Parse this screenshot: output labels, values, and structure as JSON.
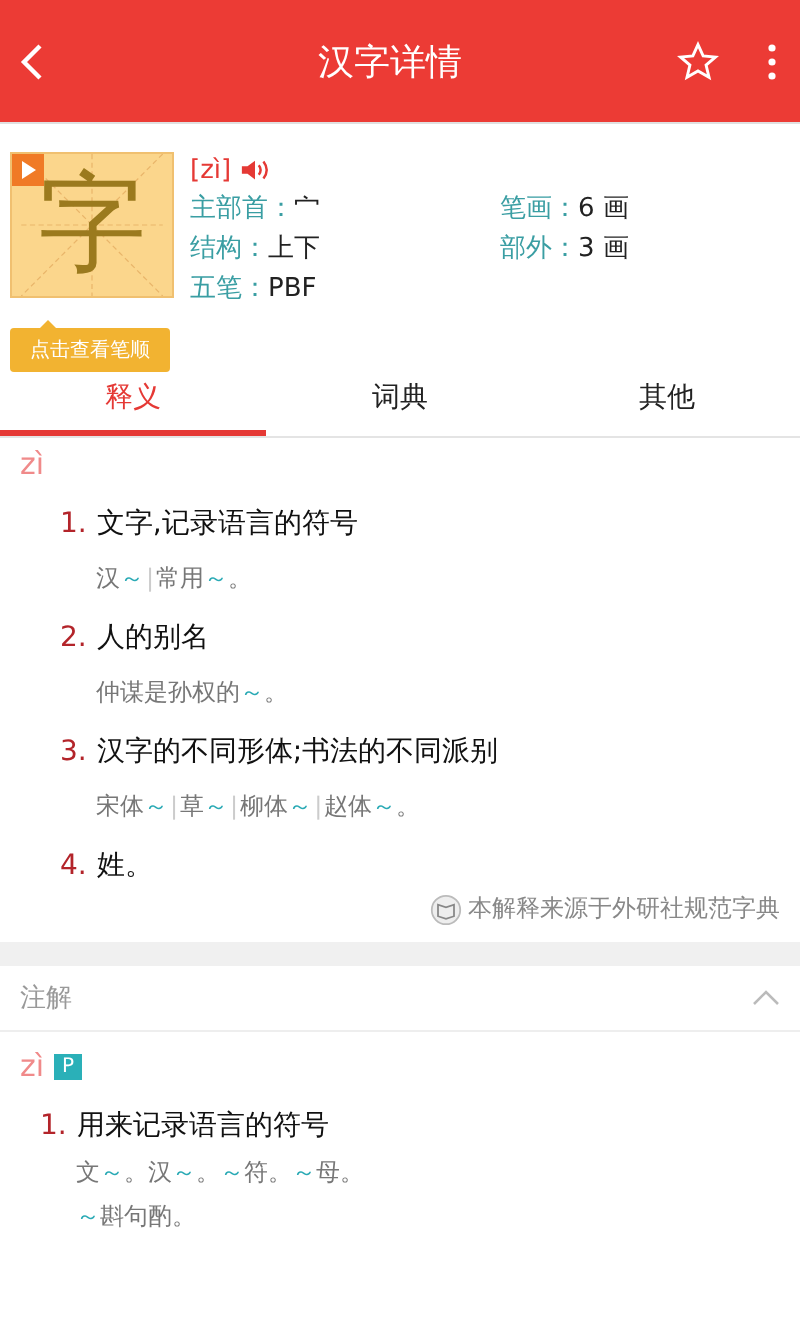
{
  "header": {
    "title": "汉字详情",
    "favorite": false
  },
  "character": {
    "glyph": "字",
    "pinyin": "[zì]",
    "stroke_button": "点击查看笔顺",
    "fields": [
      {
        "label": "主部首：",
        "value": "宀"
      },
      {
        "label": "笔画：",
        "value": "6 画"
      },
      {
        "label": "结构：",
        "value": "上下"
      },
      {
        "label": "部外：",
        "value": "3 画"
      },
      {
        "label": "五笔：",
        "value": "PBF"
      }
    ]
  },
  "tabs": [
    {
      "label": "释义",
      "selected": true
    },
    {
      "label": "词典",
      "selected": false
    },
    {
      "label": "其他",
      "selected": false
    }
  ],
  "definitions": {
    "pinyin": "zì",
    "items": [
      {
        "number": "1.",
        "text": "文字,记录语言的符号",
        "examples": [
          [
            {
              "kind": "plain",
              "text": "汉"
            },
            {
              "kind": "tilde",
              "text": "～"
            },
            {
              "kind": "sep",
              "text": "|"
            },
            {
              "kind": "plain",
              "text": "常用"
            },
            {
              "kind": "tilde",
              "text": "～"
            },
            {
              "kind": "plain",
              "text": "。"
            }
          ]
        ]
      },
      {
        "number": "2.",
        "text": "人的别名",
        "examples": [
          [
            {
              "kind": "plain",
              "text": "仲谋是孙权的"
            },
            {
              "kind": "tilde",
              "text": "～"
            },
            {
              "kind": "plain",
              "text": "。"
            }
          ]
        ]
      },
      {
        "number": "3.",
        "text": "汉字的不同形体;书法的不同派别",
        "examples": [
          [
            {
              "kind": "plain",
              "text": "宋体"
            },
            {
              "kind": "tilde",
              "text": "～"
            },
            {
              "kind": "sep",
              "text": "|"
            },
            {
              "kind": "plain",
              "text": "草"
            },
            {
              "kind": "tilde",
              "text": "～"
            },
            {
              "kind": "sep",
              "text": "|"
            },
            {
              "kind": "plain",
              "text": "柳体"
            },
            {
              "kind": "tilde",
              "text": "～"
            },
            {
              "kind": "sep",
              "text": "|"
            },
            {
              "kind": "plain",
              "text": "赵体"
            },
            {
              "kind": "tilde",
              "text": "～"
            },
            {
              "kind": "plain",
              "text": "。"
            }
          ]
        ]
      },
      {
        "number": "4.",
        "text": "姓。"
      }
    ],
    "source": "本解释来源于外研社规范字典"
  },
  "annotation": {
    "title": "注解",
    "expanded": true,
    "pinyin": "zì",
    "badge": "P",
    "items": [
      {
        "number": "1.",
        "text": "用来记录语言的符号",
        "examples": [
          [
            {
              "kind": "plain",
              "text": "文"
            },
            {
              "kind": "tilde",
              "text": "～"
            },
            {
              "kind": "plain",
              "text": "。汉"
            },
            {
              "kind": "tilde",
              "text": "～"
            },
            {
              "kind": "plain",
              "text": "。"
            },
            {
              "kind": "tilde",
              "text": "～"
            },
            {
              "kind": "plain",
              "text": "符。"
            },
            {
              "kind": "tilde",
              "text": "～"
            },
            {
              "kind": "plain",
              "text": "母。"
            }
          ],
          [
            {
              "kind": "tilde",
              "text": "～"
            },
            {
              "kind": "plain",
              "text": "斟句酌。"
            }
          ]
        ]
      }
    ]
  }
}
